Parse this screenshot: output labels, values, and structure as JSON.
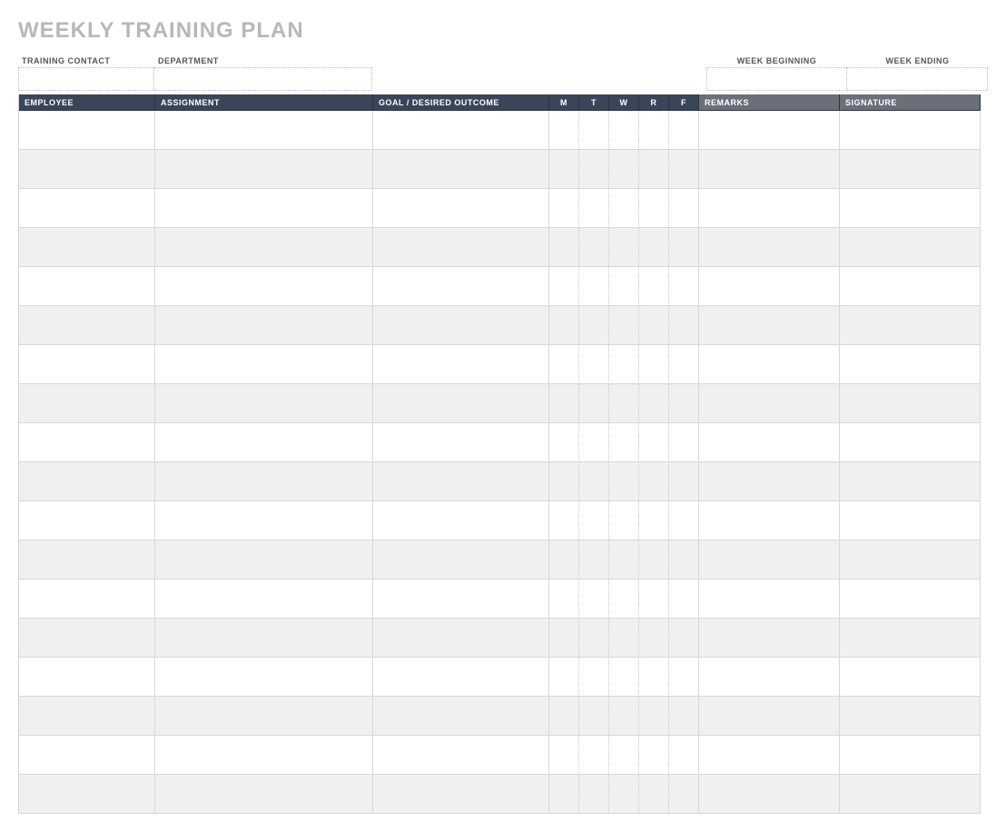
{
  "title": "WEEKLY TRAINING PLAN",
  "meta": {
    "training_contact_label": "TRAINING CONTACT",
    "training_contact_value": "",
    "department_label": "DEPARTMENT",
    "department_value": "",
    "week_beginning_label": "WEEK BEGINNING",
    "week_beginning_value": "",
    "week_ending_label": "WEEK ENDING",
    "week_ending_value": ""
  },
  "columns": {
    "employee": "EMPLOYEE",
    "assignment": "ASSIGNMENT",
    "goal": "GOAL / DESIRED OUTCOME",
    "m": "M",
    "t": "T",
    "w": "W",
    "r": "R",
    "f": "F",
    "remarks": "REMARKS",
    "signature": "SIGNATURE"
  },
  "rows": [
    {
      "employee": "",
      "assignment": "",
      "goal": "",
      "m": "",
      "t": "",
      "w": "",
      "r": "",
      "f": "",
      "remarks": "",
      "signature": ""
    },
    {
      "employee": "",
      "assignment": "",
      "goal": "",
      "m": "",
      "t": "",
      "w": "",
      "r": "",
      "f": "",
      "remarks": "",
      "signature": ""
    },
    {
      "employee": "",
      "assignment": "",
      "goal": "",
      "m": "",
      "t": "",
      "w": "",
      "r": "",
      "f": "",
      "remarks": "",
      "signature": ""
    },
    {
      "employee": "",
      "assignment": "",
      "goal": "",
      "m": "",
      "t": "",
      "w": "",
      "r": "",
      "f": "",
      "remarks": "",
      "signature": ""
    },
    {
      "employee": "",
      "assignment": "",
      "goal": "",
      "m": "",
      "t": "",
      "w": "",
      "r": "",
      "f": "",
      "remarks": "",
      "signature": ""
    },
    {
      "employee": "",
      "assignment": "",
      "goal": "",
      "m": "",
      "t": "",
      "w": "",
      "r": "",
      "f": "",
      "remarks": "",
      "signature": ""
    },
    {
      "employee": "",
      "assignment": "",
      "goal": "",
      "m": "",
      "t": "",
      "w": "",
      "r": "",
      "f": "",
      "remarks": "",
      "signature": ""
    },
    {
      "employee": "",
      "assignment": "",
      "goal": "",
      "m": "",
      "t": "",
      "w": "",
      "r": "",
      "f": "",
      "remarks": "",
      "signature": ""
    },
    {
      "employee": "",
      "assignment": "",
      "goal": "",
      "m": "",
      "t": "",
      "w": "",
      "r": "",
      "f": "",
      "remarks": "",
      "signature": ""
    },
    {
      "employee": "",
      "assignment": "",
      "goal": "",
      "m": "",
      "t": "",
      "w": "",
      "r": "",
      "f": "",
      "remarks": "",
      "signature": ""
    },
    {
      "employee": "",
      "assignment": "",
      "goal": "",
      "m": "",
      "t": "",
      "w": "",
      "r": "",
      "f": "",
      "remarks": "",
      "signature": ""
    },
    {
      "employee": "",
      "assignment": "",
      "goal": "",
      "m": "",
      "t": "",
      "w": "",
      "r": "",
      "f": "",
      "remarks": "",
      "signature": ""
    },
    {
      "employee": "",
      "assignment": "",
      "goal": "",
      "m": "",
      "t": "",
      "w": "",
      "r": "",
      "f": "",
      "remarks": "",
      "signature": ""
    },
    {
      "employee": "",
      "assignment": "",
      "goal": "",
      "m": "",
      "t": "",
      "w": "",
      "r": "",
      "f": "",
      "remarks": "",
      "signature": ""
    },
    {
      "employee": "",
      "assignment": "",
      "goal": "",
      "m": "",
      "t": "",
      "w": "",
      "r": "",
      "f": "",
      "remarks": "",
      "signature": ""
    },
    {
      "employee": "",
      "assignment": "",
      "goal": "",
      "m": "",
      "t": "",
      "w": "",
      "r": "",
      "f": "",
      "remarks": "",
      "signature": ""
    },
    {
      "employee": "",
      "assignment": "",
      "goal": "",
      "m": "",
      "t": "",
      "w": "",
      "r": "",
      "f": "",
      "remarks": "",
      "signature": ""
    },
    {
      "employee": "",
      "assignment": "",
      "goal": "",
      "m": "",
      "t": "",
      "w": "",
      "r": "",
      "f": "",
      "remarks": "",
      "signature": ""
    }
  ]
}
